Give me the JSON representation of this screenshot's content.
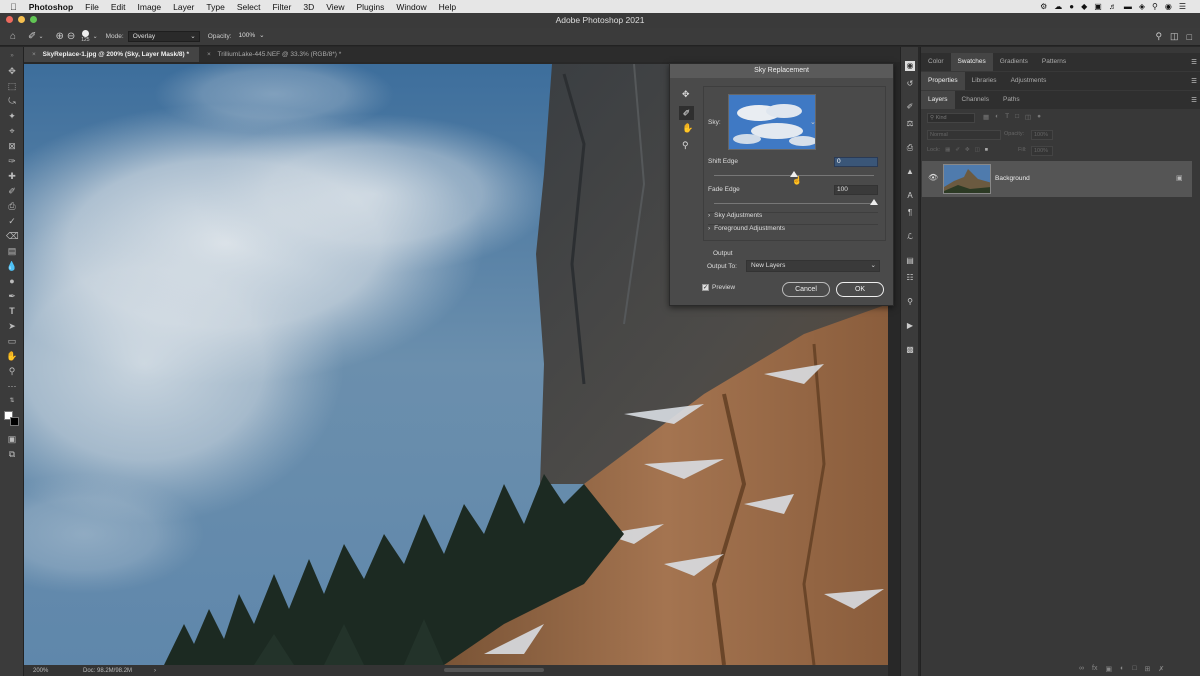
{
  "menubar": {
    "app_name": "Photoshop",
    "items": [
      "File",
      "Edit",
      "Image",
      "Layer",
      "Type",
      "Select",
      "Filter",
      "3D",
      "View",
      "Plugins",
      "Window",
      "Help"
    ]
  },
  "window": {
    "title": "Adobe Photoshop 2021"
  },
  "options": {
    "brush_size": "125",
    "mode_label": "Mode:",
    "mode_value": "Overlay",
    "opacity_label": "Opacity:",
    "opacity_value": "100%"
  },
  "doc_tabs": [
    {
      "label": "SkyReplace-1.jpg @ 200% (Sky, Layer Mask/8) *",
      "active": true
    },
    {
      "label": "TrilliumLake-445.NEF @ 33.3% (RGB/8*) *",
      "active": false
    }
  ],
  "status": {
    "zoom": "200%",
    "doc": "Doc: 98.2M/98.2M"
  },
  "panels": {
    "top_tabs": [
      "Color",
      "Swatches",
      "Gradients",
      "Patterns"
    ],
    "top_active": "Swatches",
    "mid_tabs": [
      "Properties",
      "Libraries",
      "Adjustments"
    ],
    "mid_active": "Properties",
    "layer_tabs": [
      "Layers",
      "Channels",
      "Paths"
    ],
    "layer_active": "Layers",
    "kind_placeholder": "Kind",
    "blend_mode": "Normal",
    "opacity_label": "Opacity:",
    "opacity_value": "100%",
    "lock_label": "Lock:",
    "fill_label": "Fill:",
    "fill_value": "100%",
    "layer_name": "Background"
  },
  "dialog": {
    "title": "Sky Replacement",
    "sky_label": "Sky:",
    "shift_edge_label": "Shift Edge",
    "shift_edge_value": "0",
    "shift_edge_level": 0.5,
    "fade_edge_label": "Fade Edge",
    "fade_edge_value": "100",
    "fade_edge_level": 1.0,
    "sky_adjustments": "Sky Adjustments",
    "foreground_adjustments": "Foreground Adjustments",
    "output_heading": "Output",
    "output_to_label": "Output To:",
    "output_to_value": "New Layers",
    "preview_label": "Preview",
    "preview_checked": true,
    "cancel_label": "Cancel",
    "ok_label": "OK"
  }
}
